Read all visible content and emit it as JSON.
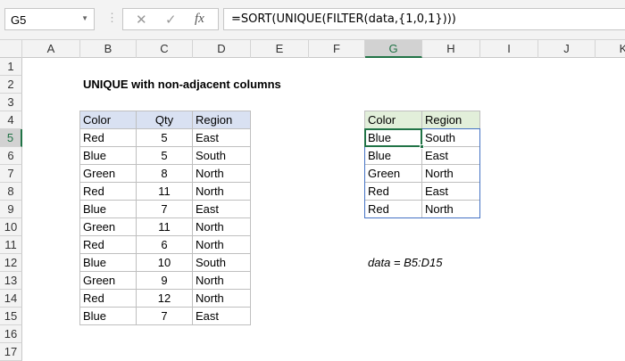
{
  "name_box": "G5",
  "formula": "=SORT(UNIQUE(FILTER(data,{1,0,1})))",
  "columns": [
    "A",
    "B",
    "C",
    "D",
    "E",
    "F",
    "G",
    "H",
    "I",
    "J",
    "K"
  ],
  "rows": [
    "1",
    "2",
    "3",
    "4",
    "5",
    "6",
    "7",
    "8",
    "9",
    "10",
    "11",
    "12",
    "13",
    "14",
    "15",
    "16",
    "17"
  ],
  "selected_cell": {
    "col": "G",
    "row": "5"
  },
  "title": "UNIQUE with non-adjacent columns",
  "source": {
    "headers": [
      "Color",
      "Qty",
      "Region"
    ],
    "rows": [
      [
        "Red",
        "5",
        "East"
      ],
      [
        "Blue",
        "5",
        "South"
      ],
      [
        "Green",
        "8",
        "North"
      ],
      [
        "Red",
        "11",
        "North"
      ],
      [
        "Blue",
        "7",
        "East"
      ],
      [
        "Green",
        "11",
        "North"
      ],
      [
        "Red",
        "6",
        "North"
      ],
      [
        "Blue",
        "10",
        "South"
      ],
      [
        "Green",
        "9",
        "North"
      ],
      [
        "Red",
        "12",
        "North"
      ],
      [
        "Blue",
        "7",
        "East"
      ]
    ]
  },
  "result": {
    "headers": [
      "Color",
      "Region"
    ],
    "rows": [
      [
        "Blue",
        "South"
      ],
      [
        "Blue",
        "East"
      ],
      [
        "Green",
        "North"
      ],
      [
        "Red",
        "East"
      ],
      [
        "Red",
        "North"
      ]
    ]
  },
  "note": "data = B5:D15",
  "colors": {
    "source_header": "#d9e1f2",
    "result_header": "#e2efda",
    "result_border": "#4472c4",
    "selection": "#217346"
  }
}
